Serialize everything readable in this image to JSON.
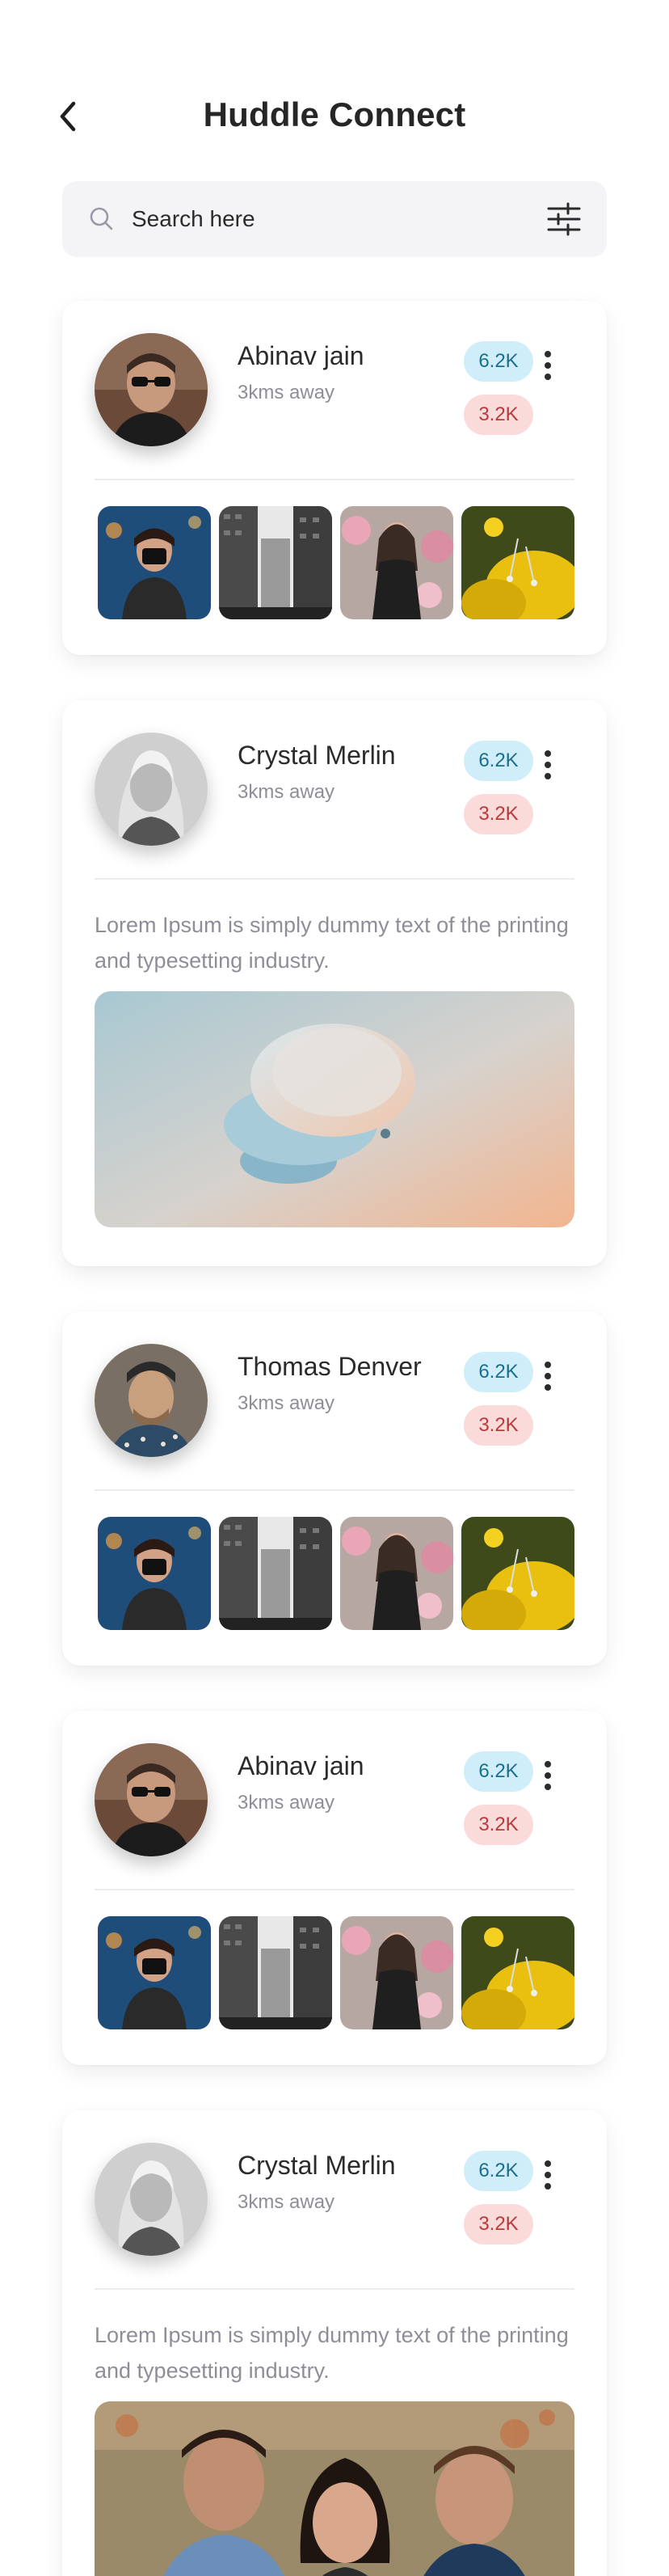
{
  "header": {
    "title": "Huddle Connect",
    "back_icon": "chevron-left-icon"
  },
  "search": {
    "placeholder": "Search here",
    "icon": "search-icon",
    "filter_icon": "sliders-icon"
  },
  "colors": {
    "badge_blue_bg": "#cfeefa",
    "badge_red_bg": "#fbdada",
    "muted_text": "#8e8e99"
  },
  "cards": [
    {
      "name": "Abinav jain",
      "distance": "3kms away",
      "badge_likes": "6.2K",
      "badge_hearts": "3.2K",
      "type": "gallery"
    },
    {
      "name": "Crystal Merlin",
      "distance": "3kms away",
      "badge_likes": "6.2K",
      "badge_hearts": "3.2K",
      "type": "post",
      "caption": "Lorem Ipsum is simply dummy text of the printing and typesetting industry."
    },
    {
      "name": "Thomas Denver",
      "distance": "3kms away",
      "badge_likes": "6.2K",
      "badge_hearts": "3.2K",
      "type": "gallery"
    },
    {
      "name": "Abinav jain",
      "distance": "3kms away",
      "badge_likes": "6.2K",
      "badge_hearts": "3.2K",
      "type": "gallery"
    },
    {
      "name": "Crystal Merlin",
      "distance": "3kms away",
      "badge_likes": "6.2K",
      "badge_hearts": "3.2K",
      "type": "post",
      "caption": "Lorem Ipsum is simply dummy text of the printing and typesetting industry."
    }
  ]
}
